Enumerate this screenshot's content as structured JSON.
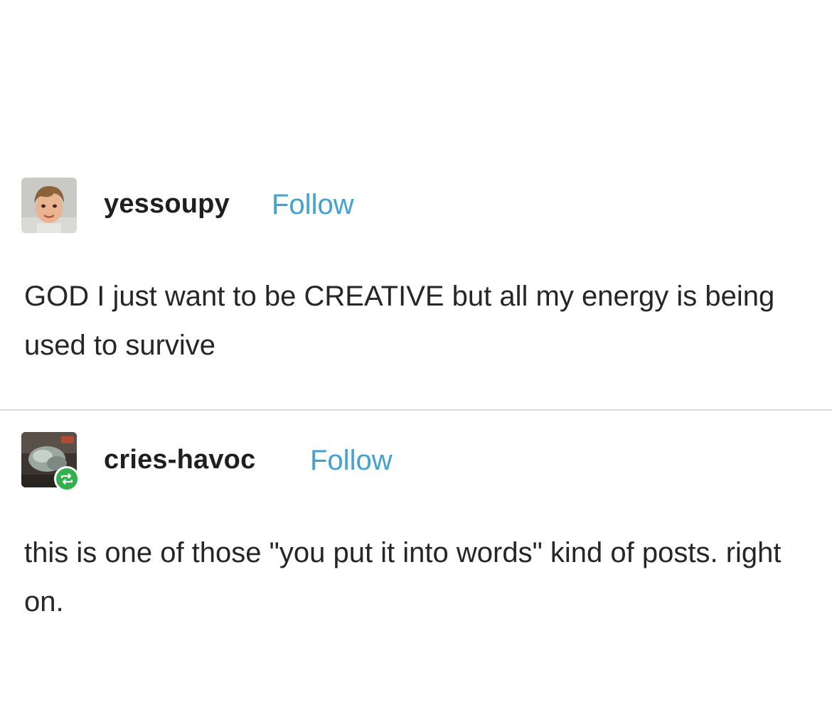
{
  "posts": [
    {
      "username": "yessoupy",
      "follow_label": "Follow",
      "avatar_icon": "child-portrait-avatar",
      "text": "GOD I just want to be CREATIVE but all my energy is being used to survive"
    },
    {
      "username": "cries-havoc",
      "follow_label": "Follow",
      "avatar_icon": "photo-avatar",
      "badge_icon": "reblog-icon",
      "text": "this is one of those \"you put it into words\" kind of posts. right on."
    }
  ],
  "colors": {
    "follow": "#42a2d6",
    "reblog_badge": "#2fb24b",
    "divider": "#dcdcdc"
  }
}
